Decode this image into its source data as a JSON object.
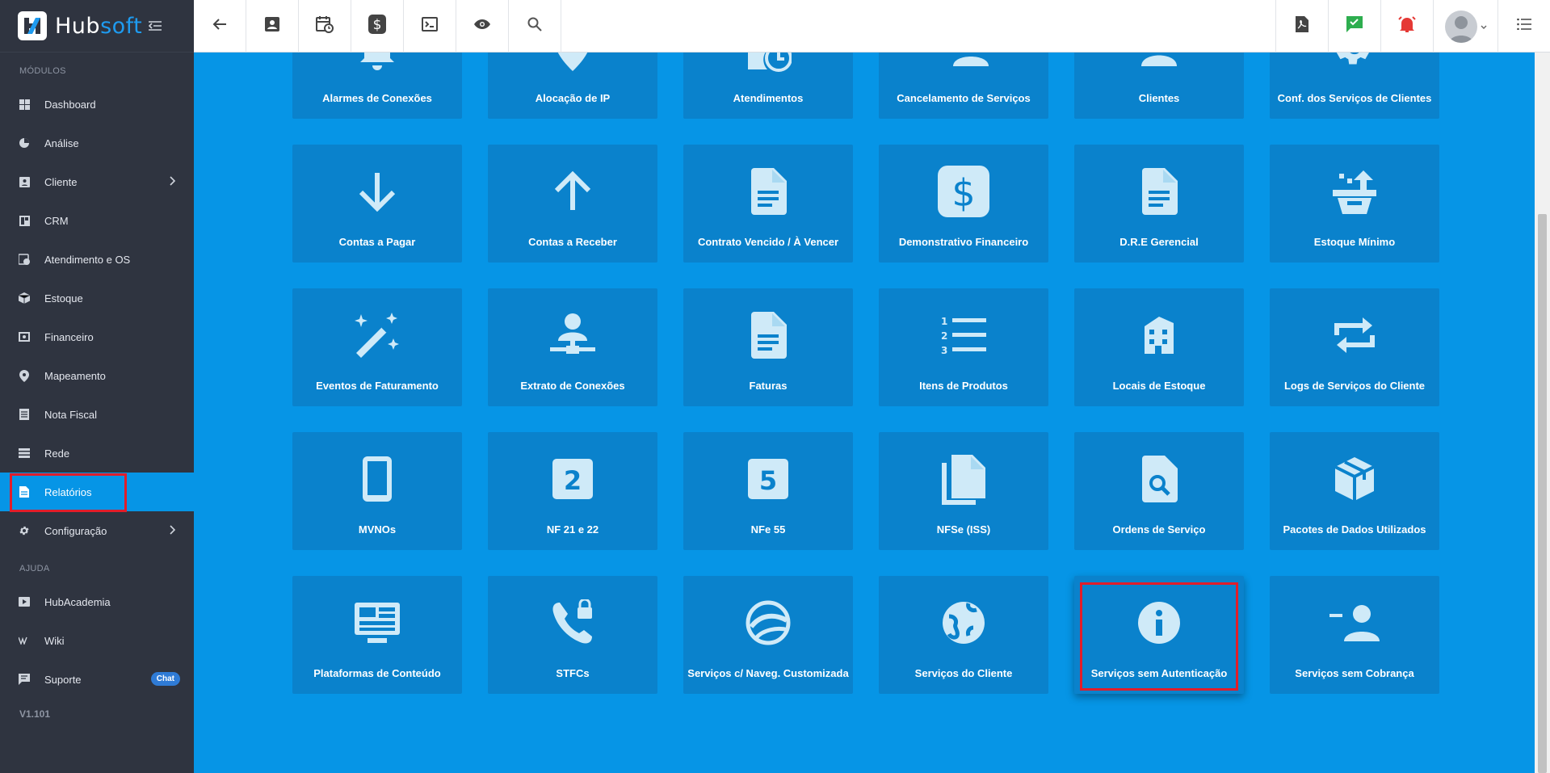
{
  "brand": {
    "name_part1": "Hub",
    "name_part2": "soft"
  },
  "sidebar": {
    "section_modules": "MÓDULOS",
    "items": [
      {
        "label": "Dashboard",
        "icon": "dashboard-icon"
      },
      {
        "label": "Análise",
        "icon": "pie-chart-icon"
      },
      {
        "label": "Cliente",
        "icon": "contact-card-icon",
        "has_submenu": true
      },
      {
        "label": "CRM",
        "icon": "crm-board-icon"
      },
      {
        "label": "Atendimento e OS",
        "icon": "calendar-clock-icon"
      },
      {
        "label": "Estoque",
        "icon": "box-icon"
      },
      {
        "label": "Financeiro",
        "icon": "money-icon"
      },
      {
        "label": "Mapeamento",
        "icon": "map-pin-icon"
      },
      {
        "label": "Nota Fiscal",
        "icon": "receipt-icon"
      },
      {
        "label": "Rede",
        "icon": "network-icon"
      },
      {
        "label": "Relatórios",
        "icon": "report-icon",
        "active": true
      },
      {
        "label": "Configuração",
        "icon": "gear-icon",
        "has_submenu": true
      }
    ],
    "section_help": "AJUDA",
    "help_items": [
      {
        "label": "HubAcademia",
        "icon": "video-icon"
      },
      {
        "label": "Wiki",
        "icon": "wiki-icon"
      },
      {
        "label": "Suporte",
        "icon": "chat-icon",
        "badge": "Chat"
      }
    ],
    "version": "V1.101"
  },
  "topbar": {
    "left_icons": [
      "back-arrow-icon",
      "contact-card-icon",
      "calendar-clock-icon",
      "dollar-icon",
      "terminal-icon",
      "eye-icon",
      "search-icon"
    ],
    "right_icons": [
      "pdf-icon",
      "chat-check-icon",
      "alarm-bell-icon",
      "avatar",
      "list-menu-icon"
    ],
    "accent_green": "#2eae4f",
    "accent_red": "#e53935"
  },
  "reports": {
    "tiles": [
      {
        "label": "Alarmes de Conexões",
        "icon": "alarm-bell-icon"
      },
      {
        "label": "Alocação de IP",
        "icon": "map-pin-icon"
      },
      {
        "label": "Atendimentos",
        "icon": "calendar-clock-icon"
      },
      {
        "label": "Cancelamento de Serviços",
        "icon": "person-remove-icon"
      },
      {
        "label": "Clientes",
        "icon": "person-icon"
      },
      {
        "label": "Conf. dos Serviços de Clientes",
        "icon": "gear-icon"
      },
      {
        "label": "Contas a Pagar",
        "icon": "arrow-down-icon"
      },
      {
        "label": "Contas a Receber",
        "icon": "arrow-up-icon"
      },
      {
        "label": "Contrato Vencido / À Vencer",
        "icon": "document-icon"
      },
      {
        "label": "Demonstrativo Financeiro",
        "icon": "dollar-box-icon"
      },
      {
        "label": "D.R.E Gerencial",
        "icon": "document-icon"
      },
      {
        "label": "Estoque Mínimo",
        "icon": "basket-upload-icon"
      },
      {
        "label": "Eventos de Faturamento",
        "icon": "magic-wand-icon"
      },
      {
        "label": "Extrato de Conexões",
        "icon": "network-person-icon"
      },
      {
        "label": "Faturas",
        "icon": "document-icon"
      },
      {
        "label": "Itens de Produtos",
        "icon": "numbered-list-icon"
      },
      {
        "label": "Locais de Estoque",
        "icon": "building-icon"
      },
      {
        "label": "Logs de Serviços do Cliente",
        "icon": "repeat-icon"
      },
      {
        "label": "MVNOs",
        "icon": "tablet-icon"
      },
      {
        "label": "NF 21 e 22",
        "icon": "box-two-icon"
      },
      {
        "label": "NFe 55",
        "icon": "box-five-icon"
      },
      {
        "label": "NFSe (ISS)",
        "icon": "copy-documents-icon"
      },
      {
        "label": "Ordens de Serviço",
        "icon": "file-search-icon"
      },
      {
        "label": "Pacotes de Dados Utilizados",
        "icon": "package-icon"
      },
      {
        "label": "Plataformas de Conteúdo",
        "icon": "monitor-dashboard-icon"
      },
      {
        "label": "STFCs",
        "icon": "phone-lock-icon"
      },
      {
        "label": "Serviços c/ Naveg. Customizada",
        "icon": "google-earth-icon"
      },
      {
        "label": "Serviços do Cliente",
        "icon": "globe-icon"
      },
      {
        "label": "Serviços sem Autenticação",
        "icon": "info-icon",
        "highlighted": true
      },
      {
        "label": "Serviços sem Cobrança",
        "icon": "person-minus-icon"
      }
    ]
  },
  "colors": {
    "sidebar_bg": "#2f3440",
    "main_bg": "#0695e6",
    "tile_bg": "#0a82cc",
    "highlight_border": "#e11d2a"
  }
}
